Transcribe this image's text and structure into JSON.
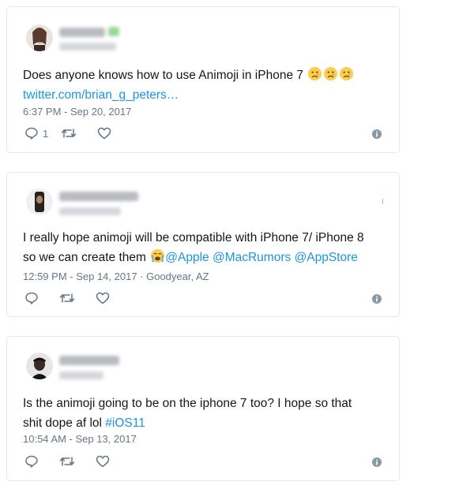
{
  "tweets": [
    {
      "text": "Does anyone knows how to use Animoji in iPhone 7",
      "emojis": [
        "crying-face-emoji",
        "crying-face-emoji",
        "crying-face-emoji"
      ],
      "link": "twitter.com/brian_g_peters…",
      "timestamp": "6:37 PM - Sep 20, 2017",
      "reply_count": "1",
      "icons": [
        "reply-icon",
        "retweet-icon",
        "like-icon",
        "info-icon"
      ]
    },
    {
      "text_line1": "I really hope animoji will be compatible with iPhone 7/ iPhone 8",
      "text_line2_pre": "so we can create them",
      "emojis": [
        "loudly-crying-face-emoji"
      ],
      "mentions": [
        "@Apple",
        "@MacRumors",
        "@AppStore"
      ],
      "timestamp": "12:59 PM - Sep 14, 2017",
      "location": "· Goodyear, AZ",
      "icons": [
        "reply-icon",
        "retweet-icon",
        "like-icon",
        "info-icon"
      ]
    },
    {
      "text_line1": "Is the animoji going to be on the iphone 7 too? I hope so that",
      "text_line2_pre": "shit dope af lol",
      "hashtag": "#iOS11",
      "timestamp": "10:54 AM - Sep 13, 2017",
      "icons": [
        "reply-icon",
        "retweet-icon",
        "like-icon",
        "info-icon"
      ]
    }
  ],
  "colors": {
    "link": "#1b95e0",
    "text": "#14171a",
    "meta": "#657786",
    "border": "#e1e8ed"
  }
}
